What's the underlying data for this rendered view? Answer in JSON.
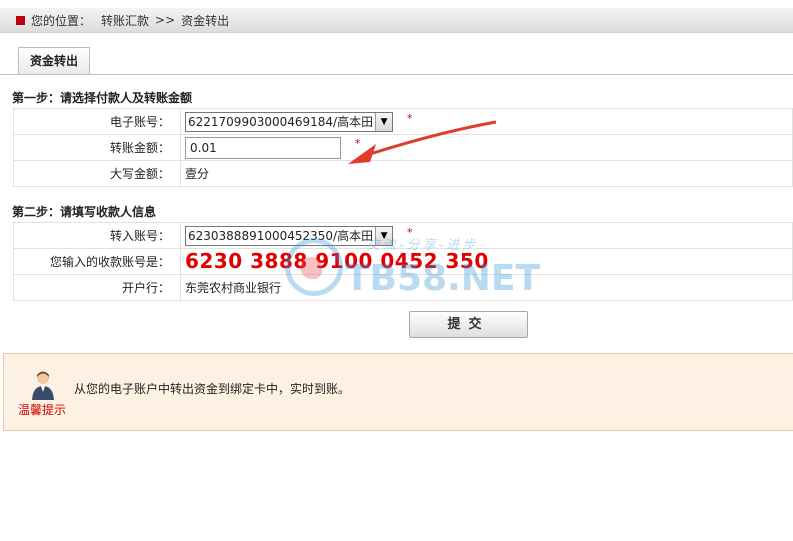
{
  "breadcrumb": {
    "prefix": "您的位置：",
    "level1": "转账汇款",
    "separator": ">>",
    "level2": "资金转出"
  },
  "tab": {
    "label": "资金转出"
  },
  "step1": {
    "title": "第一步：请选择付款人及转账金额",
    "rows": {
      "account_label": "电子账号：",
      "account_value": "6221709903000469184/高本田",
      "amount_label": "转账金额：",
      "amount_value": "0.01",
      "capital_label": "大写金额：",
      "capital_value": "壹分"
    },
    "required_mark": "*"
  },
  "step2": {
    "title": "第二步：请填写收款人信息",
    "rows": {
      "account_label": "转入账号：",
      "account_value": "6230388891000452350/高本田",
      "entered_label": "您输入的收款账号是：",
      "entered_value": "6230 3888 9100 0452 350",
      "bank_label": "开户行：",
      "bank_value": "东莞农村商业银行"
    },
    "required_mark": "*"
  },
  "submit": {
    "label": "提交"
  },
  "tip": {
    "label": "温馨提示",
    "text": "从您的电子账户中转出资金到绑定卡中，实时到账。"
  },
  "watermark": {
    "text": "TB58.NET",
    "slogan": "交流-分享-进步"
  },
  "colors": {
    "accent_red": "#c0000a",
    "account_highlight": "#e00000",
    "tip_background": "#fdf1e3",
    "annotation_arrow": "#e33a2e"
  }
}
